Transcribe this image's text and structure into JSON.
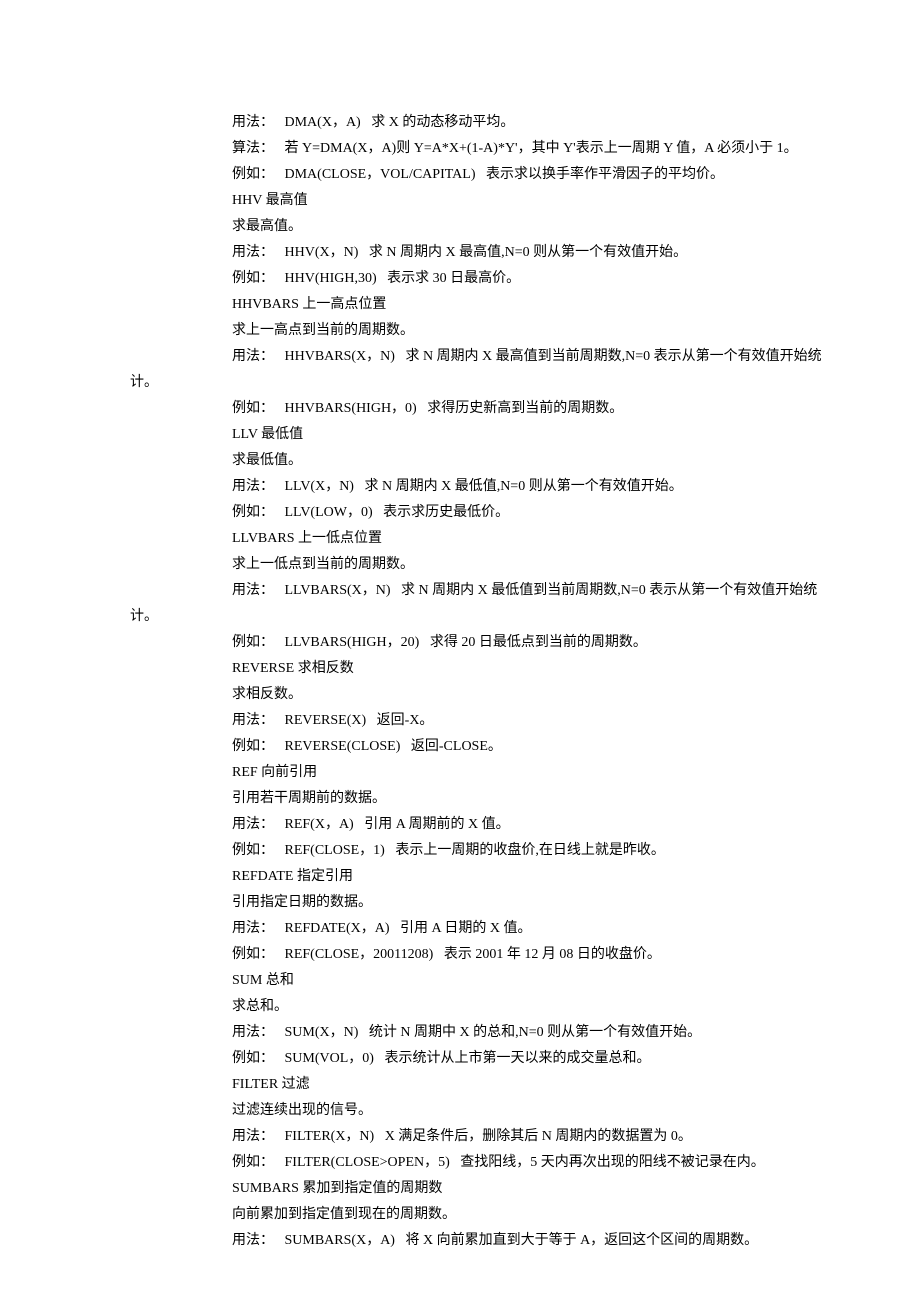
{
  "lines": [
    {
      "cls": "indent1",
      "text": "用法：   DMA(X，A)   求 X 的动态移动平均。"
    },
    {
      "cls": "indent1",
      "text": "算法：   若 Y=DMA(X，A)则 Y=A*X+(1-A)*Y'，其中 Y'表示上一周期 Y 值，A 必须小于 1。"
    },
    {
      "cls": "indent1",
      "text": "例如：   DMA(CLOSE，VOL/CAPITAL)   表示求以换手率作平滑因子的平均价。"
    },
    {
      "cls": "indent1",
      "text": "HHV 最高值"
    },
    {
      "cls": "indent1",
      "text": "求最高值。"
    },
    {
      "cls": "indent1",
      "text": "用法：   HHV(X，N)   求 N 周期内 X 最高值,N=0 则从第一个有效值开始。"
    },
    {
      "cls": "indent1",
      "text": "例如：   HHV(HIGH,30)   表示求 30 日最高价。"
    },
    {
      "cls": "indent1",
      "text": "HHVBARS 上一高点位置"
    },
    {
      "cls": "indent1",
      "text": "求上一高点到当前的周期数。"
    },
    {
      "cls": "indent1",
      "text": "用法：   HHVBARS(X，N)   求 N 周期内 X 最高值到当前周期数,N=0 表示从第一个有效值开始统"
    },
    {
      "cls": "indent0",
      "text": "计。"
    },
    {
      "cls": "indent1",
      "text": "例如：   HHVBARS(HIGH，0)   求得历史新高到当前的周期数。"
    },
    {
      "cls": "indent1",
      "text": "LLV 最低值"
    },
    {
      "cls": "indent1",
      "text": "求最低值。"
    },
    {
      "cls": "indent1",
      "text": "用法：   LLV(X，N)   求 N 周期内 X 最低值,N=0 则从第一个有效值开始。"
    },
    {
      "cls": "indent1",
      "text": "例如：   LLV(LOW，0)   表示求历史最低价。"
    },
    {
      "cls": "indent1",
      "text": "LLVBARS 上一低点位置"
    },
    {
      "cls": "indent1",
      "text": "求上一低点到当前的周期数。"
    },
    {
      "cls": "indent1",
      "text": "用法：   LLVBARS(X，N)   求 N 周期内 X 最低值到当前周期数,N=0 表示从第一个有效值开始统"
    },
    {
      "cls": "indent0",
      "text": "计。"
    },
    {
      "cls": "indent1",
      "text": "例如：   LLVBARS(HIGH，20)   求得 20 日最低点到当前的周期数。"
    },
    {
      "cls": "indent1",
      "text": "REVERSE 求相反数"
    },
    {
      "cls": "indent1",
      "text": "求相反数。"
    },
    {
      "cls": "indent1",
      "text": "用法：   REVERSE(X)   返回-X。"
    },
    {
      "cls": "indent1",
      "text": "例如：   REVERSE(CLOSE)   返回-CLOSE。"
    },
    {
      "cls": "indent1",
      "text": "REF 向前引用"
    },
    {
      "cls": "indent1",
      "text": "引用若干周期前的数据。"
    },
    {
      "cls": "indent1",
      "text": "用法：   REF(X，A)   引用 A 周期前的 X 值。"
    },
    {
      "cls": "indent1",
      "text": "例如：   REF(CLOSE，1)   表示上一周期的收盘价,在日线上就是昨收。"
    },
    {
      "cls": "indent1",
      "text": "REFDATE 指定引用"
    },
    {
      "cls": "indent1",
      "text": "引用指定日期的数据。"
    },
    {
      "cls": "indent1",
      "text": "用法：   REFDATE(X，A)   引用 A 日期的 X 值。"
    },
    {
      "cls": "indent1",
      "text": "例如：   REF(CLOSE，20011208)   表示 2001 年 12 月 08 日的收盘价。"
    },
    {
      "cls": "indent1",
      "text": "SUM 总和"
    },
    {
      "cls": "indent1",
      "text": "求总和。"
    },
    {
      "cls": "indent1",
      "text": "用法：   SUM(X，N)   统计 N 周期中 X 的总和,N=0 则从第一个有效值开始。"
    },
    {
      "cls": "indent1",
      "text": "例如：   SUM(VOL，0)   表示统计从上市第一天以来的成交量总和。"
    },
    {
      "cls": "indent1",
      "text": "FILTER 过滤"
    },
    {
      "cls": "indent1",
      "text": "过滤连续出现的信号。"
    },
    {
      "cls": "indent1",
      "text": "用法：   FILTER(X，N)   X 满足条件后，删除其后 N 周期内的数据置为 0。"
    },
    {
      "cls": "indent1",
      "text": "例如：   FILTER(CLOSE>OPEN，5)   查找阳线，5 天内再次出现的阳线不被记录在内。"
    },
    {
      "cls": "indent1",
      "text": "SUMBARS 累加到指定值的周期数"
    },
    {
      "cls": "indent1",
      "text": "向前累加到指定值到现在的周期数。"
    },
    {
      "cls": "indent1",
      "text": "用法：   SUMBARS(X，A)   将 X 向前累加直到大于等于 A，返回这个区间的周期数。"
    }
  ]
}
